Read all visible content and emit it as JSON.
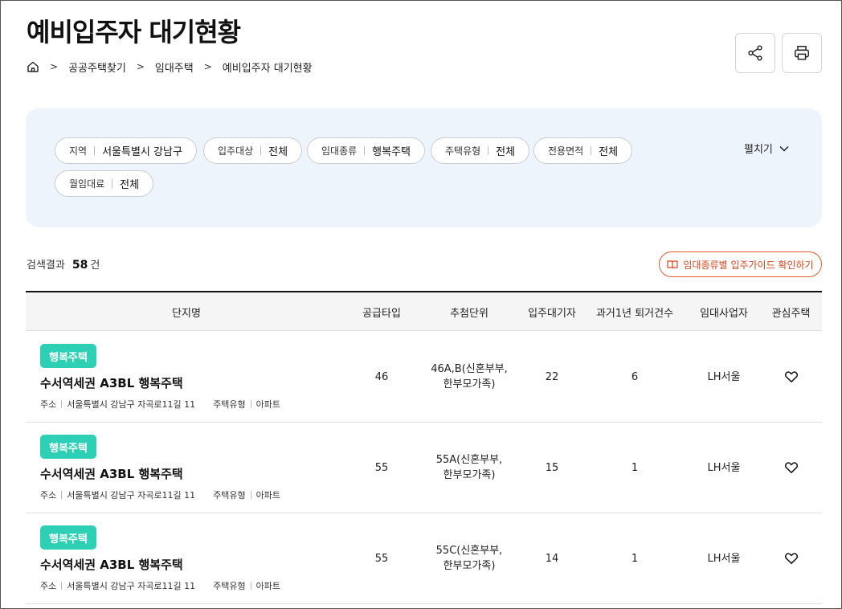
{
  "page": {
    "title": "예비입주자 대기현황"
  },
  "breadcrumb": {
    "home_icon": "home-icon",
    "items": [
      "공공주택찾기",
      "임대주택",
      "예비입주자 대기현황"
    ]
  },
  "toolbar": {
    "share_icon": "share-icon",
    "print_icon": "print-icon"
  },
  "filters": [
    {
      "key": "지역",
      "value": "서울특별시 강남구"
    },
    {
      "key": "입주대상",
      "value": "전체"
    },
    {
      "key": "임대종류",
      "value": "행복주택"
    },
    {
      "key": "주택유형",
      "value": "전체"
    },
    {
      "key": "전용면적",
      "value": "전체"
    },
    {
      "key": "월임대료",
      "value": "전체"
    }
  ],
  "expand_label": "펼치기",
  "results": {
    "label": "검색결과",
    "count": "58",
    "unit": "건"
  },
  "guide_button": {
    "label": "임대종류별 입주가이드 확인하기",
    "accent": "#e05a2b"
  },
  "table": {
    "headers": [
      "단지명",
      "공급타입",
      "추첨단위",
      "입주대기자",
      "과거1년 퇴거건수",
      "임대사업자",
      "관심주택"
    ],
    "rows": [
      {
        "badge": "행복주택",
        "name": "수서역세권 A3BL 행복주택",
        "addr_label": "주소",
        "addr": "서울특별시 강남구 자곡로11길 11",
        "type_label": "주택유형",
        "type": "아파트",
        "supply_type": "46",
        "unit_line1": "46A,B(신혼부부,",
        "unit_line2": "한부모가족)",
        "waiting": "22",
        "moveouts": "6",
        "operator": "LH서울"
      },
      {
        "badge": "행복주택",
        "name": "수서역세권 A3BL 행복주택",
        "addr_label": "주소",
        "addr": "서울특별시 강남구 자곡로11길 11",
        "type_label": "주택유형",
        "type": "아파트",
        "supply_type": "55",
        "unit_line1": "55A(신혼부부,",
        "unit_line2": "한부모가족)",
        "waiting": "15",
        "moveouts": "1",
        "operator": "LH서울"
      },
      {
        "badge": "행복주택",
        "name": "수서역세권 A3BL 행복주택",
        "addr_label": "주소",
        "addr": "서울특별시 강남구 자곡로11길 11",
        "type_label": "주택유형",
        "type": "아파트",
        "supply_type": "55",
        "unit_line1": "55C(신혼부부,",
        "unit_line2": "한부모가족)",
        "waiting": "14",
        "moveouts": "1",
        "operator": "LH서울"
      }
    ]
  },
  "colors": {
    "badge": "#2dd0b4",
    "panel": "#eef4fc"
  }
}
